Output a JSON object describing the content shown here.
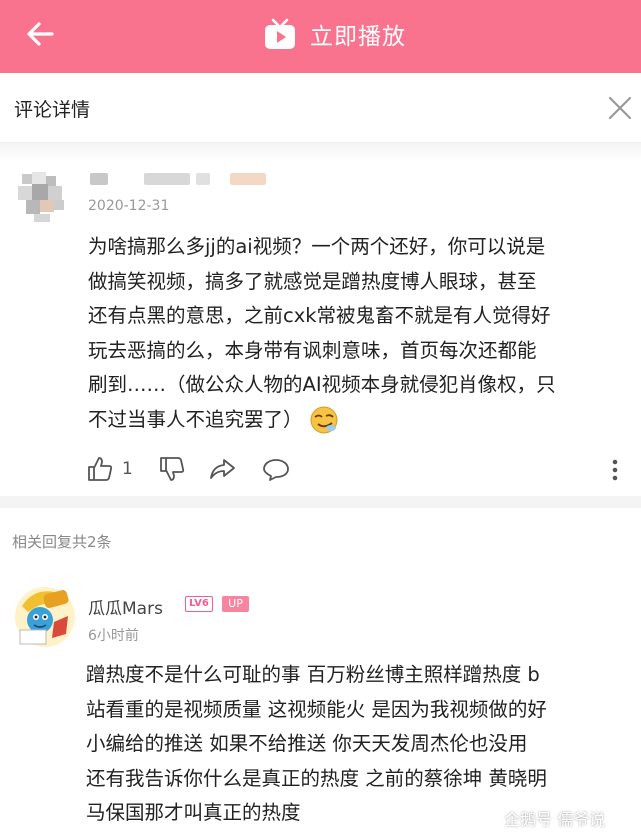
{
  "header": {
    "play_label": "立即播放"
  },
  "sheet": {
    "title": "评论详情"
  },
  "comment": {
    "date": "2020-12-31",
    "lines": [
      "为啥搞那么多jj的ai视频？一个两个还好，你可以说是",
      "做搞笑视频，搞多了就感觉是蹭热度博人眼球，甚至",
      "还有点黑的意思，之前cxk常被鬼畜不就是有人觉得好",
      "玩去恶搞的么，本身带有讽刺意味，首页每次还都能",
      "刷到……（做公众人物的AI视频本身就侵犯肖像权，只",
      "不过当事人不追究罢了）"
    ],
    "like_count": "1"
  },
  "related": {
    "label": "相关回复共2条"
  },
  "reply": {
    "username": "瓜瓜Mars",
    "level": "LV6",
    "up_badge": "UP",
    "time": "6小时前",
    "lines": [
      "蹭热度不是什么可耻的事 百万粉丝博主照样蹭热度 b",
      "站看重的是视频质量 这视频能火 是因为我视频做的好",
      "小编给的推送 如果不给推送 你天天发周杰伦也没用",
      "还有我告诉你什么是真正的热度 之前的蔡徐坤 黄晓明",
      "马保国那才叫真正的热度"
    ]
  },
  "watermark": {
    "text": "企鹅号 儒爷说"
  },
  "colors": {
    "accent": "#f9738f",
    "badge": "#f25d8e"
  }
}
